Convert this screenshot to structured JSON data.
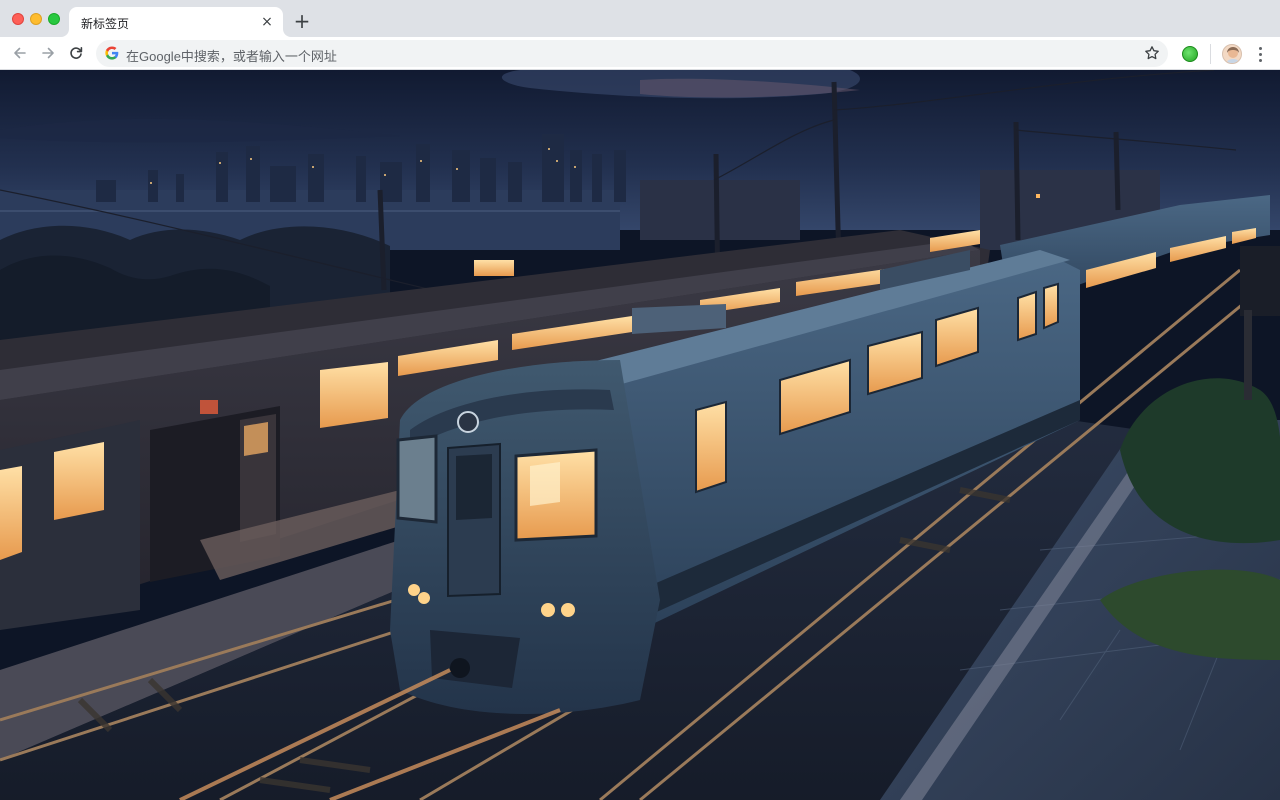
{
  "window": {
    "tab_title": "新标签页",
    "tab_close_glyph": "×",
    "new_tab_glyph": "+"
  },
  "toolbar": {
    "back_icon": "arrow-left-icon",
    "forward_icon": "arrow-right-icon",
    "reload_icon": "reload-icon",
    "omnibox_placeholder": "在Google中搜索，或者输入一个网址",
    "bookmark_icon": "star-icon",
    "extension_icon": "green-extension-icon",
    "profile_icon": "avatar-icon",
    "menu_icon": "kebab-menu-icon"
  },
  "wallpaper": {
    "description_icon": "night-train-station-wallpaper",
    "colors": {
      "sky_top": "#0f1a33",
      "sky_bottom": "#2a3a5c",
      "train_body": "#3b5672",
      "window_glow": "#f3c27a",
      "platform": "#3a4a63"
    }
  }
}
